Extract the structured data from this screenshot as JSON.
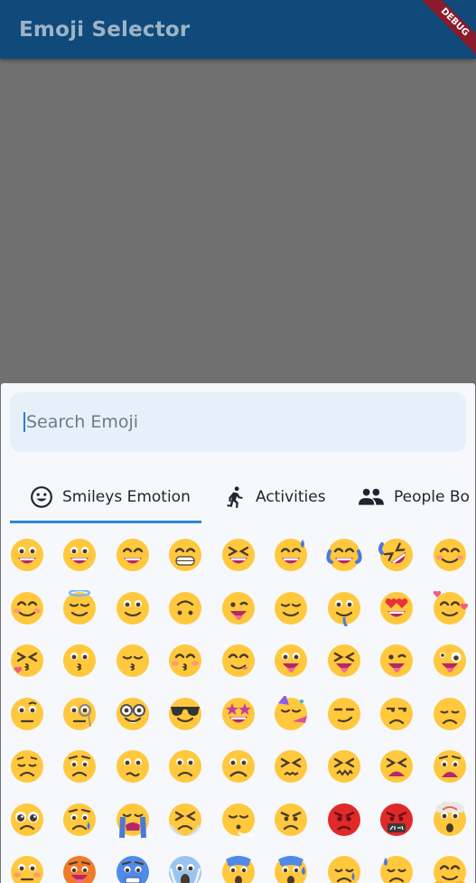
{
  "app": {
    "title": "Emoji Selector",
    "debug_banner": "DEBUG",
    "colors": {
      "appbar": "#0f4a7a",
      "accent": "#2e86d6",
      "face": "#ffc83d",
      "scrim": "#707070"
    }
  },
  "search": {
    "placeholder": "Search Emoji",
    "value": ""
  },
  "tabs": [
    {
      "label": "Smileys Emotion",
      "icon": "smiley-face-icon",
      "selected": true
    },
    {
      "label": "Activities",
      "icon": "running-person-icon",
      "selected": false
    },
    {
      "label": "People Bo",
      "icon": "people-icon",
      "selected": false
    }
  ],
  "emoji_rows": [
    [
      "grinning",
      "grinning-big-eyes",
      "grinning-smiling-eyes",
      "beaming",
      "squinting-laugh",
      "grinning-sweat",
      "tears-of-joy",
      "rolling-laughing",
      "smiling-blush"
    ],
    [
      "smiling-blush-2",
      "halo",
      "slightly-smiling",
      "upside-down",
      "winking",
      "relieved",
      "melting",
      "heart-eyes",
      "smiling-hearts"
    ],
    [
      "kissing-heart",
      "kissing",
      "kissing-closed-eyes",
      "kissing-smiling-eyes",
      "yum",
      "tongue",
      "squinting-tongue",
      "winking-tongue",
      "zany"
    ],
    [
      "raised-eyebrow",
      "monocle",
      "nerd",
      "sunglasses",
      "star-struck",
      "partying",
      "smirking",
      "unamused",
      "disappointed"
    ],
    [
      "pensive",
      "worried",
      "confused",
      "slightly-frowning",
      "frowning",
      "persevering",
      "confounded",
      "tired",
      "weary"
    ],
    [
      "pleading",
      "crying",
      "loudly-crying",
      "steam-nose",
      "exhaling",
      "angry",
      "pouting",
      "cursing",
      "exploding-head"
    ],
    [
      "flushed",
      "hot-face",
      "cold-face",
      "scream",
      "fearful",
      "anxious-sweat",
      "sad-relieved",
      "downcast-sweat",
      "hugging"
    ]
  ]
}
